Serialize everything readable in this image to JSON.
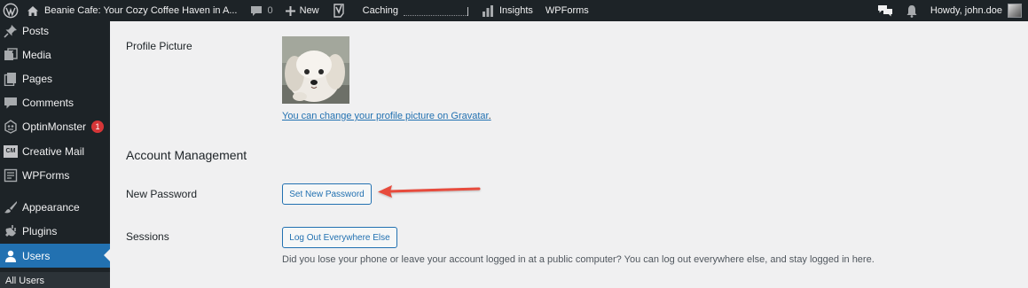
{
  "admin_bar": {
    "site_name": "Beanie Cafe: Your Cozy Coffee Haven in A...",
    "comments_count": "0",
    "new_label": "New",
    "caching_label": "Caching",
    "insights_label": "Insights",
    "wpforms_label": "WPForms",
    "howdy_label": "Howdy, john.doe"
  },
  "sidebar": {
    "items": [
      {
        "label": "Posts",
        "icon": "pin-icon"
      },
      {
        "label": "Media",
        "icon": "media-icon"
      },
      {
        "label": "Pages",
        "icon": "pages-icon"
      },
      {
        "label": "Comments",
        "icon": "comment-icon"
      },
      {
        "label": "OptinMonster",
        "icon": "optinmonster-icon",
        "badge": "1"
      },
      {
        "label": "Creative Mail",
        "icon": "creative-mail-icon",
        "icon_text": "CM"
      },
      {
        "label": "WPForms",
        "icon": "wpforms-icon"
      },
      {
        "label": "Appearance",
        "icon": "brush-icon"
      },
      {
        "label": "Plugins",
        "icon": "plug-icon"
      },
      {
        "label": "Users",
        "icon": "user-icon",
        "active": true
      }
    ],
    "submenu_label": "All Users"
  },
  "profile": {
    "picture_label": "Profile Picture",
    "gravatar_link": "You can change your profile picture on Gravatar",
    "gravatar_punct": "."
  },
  "account": {
    "section_title": "Account Management",
    "new_password_label": "New Password",
    "set_password_button": "Set New Password",
    "sessions_label": "Sessions",
    "logout_button": "Log Out Everywhere Else",
    "sessions_description": "Did you lose your phone or leave your account logged in at a public computer? You can log out everywhere else, and stay logged in here."
  },
  "colors": {
    "admin_bar_bg": "#1d2327",
    "accent": "#2271b1",
    "arrow": "#e74c3c",
    "badge": "#d63638"
  }
}
